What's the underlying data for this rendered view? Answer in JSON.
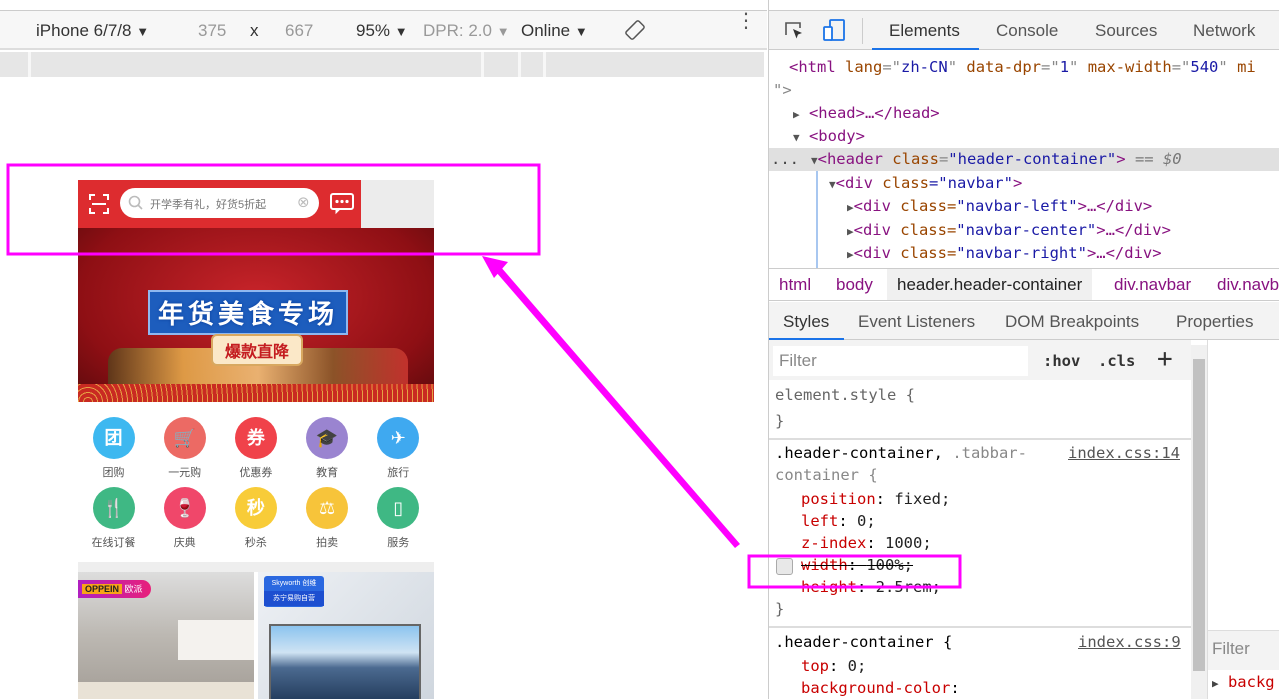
{
  "device_toolbar": {
    "device": "iPhone 6/7/8",
    "width": "375",
    "times": "x",
    "height": "667",
    "zoom": "95%",
    "dpr": "DPR: 2.0",
    "network": "Online",
    "dropdown": "▼",
    "rotate_icon": "rotate-icon",
    "more_icon": "more-vertical-icon"
  },
  "phone": {
    "header_color": "#dd2c2f",
    "search_placeholder": "开学季有礼，好货5折起",
    "banner": {
      "title": "年货美食专场",
      "tag": "爆款直降"
    },
    "icons": [
      {
        "label": "团购",
        "color": "#3db8f0",
        "glyph": "团"
      },
      {
        "label": "一元购",
        "color": "#ec6a64",
        "glyph": "🛒"
      },
      {
        "label": "优惠券",
        "color": "#f0424a",
        "glyph": "券"
      },
      {
        "label": "教育",
        "color": "#9a84d0",
        "glyph": "🎓"
      },
      {
        "label": "旅行",
        "color": "#3fa9f0",
        "glyph": "✈"
      },
      {
        "label": "在线订餐",
        "color": "#3fb884",
        "glyph": "🍴"
      },
      {
        "label": "庆典",
        "color": "#f0476a",
        "glyph": "🍷"
      },
      {
        "label": "秒杀",
        "color": "#f8cc38",
        "glyph": "秒"
      },
      {
        "label": "拍卖",
        "color": "#f7c43a",
        "glyph": "⚖"
      },
      {
        "label": "服务",
        "color": "#3fb884",
        "glyph": "▯"
      }
    ],
    "promo_left": {
      "brand": "OPPEIN",
      "tag": "欧派"
    },
    "promo_right": {
      "brand": "Skyworth 创维",
      "sub": "苏宁易购自营"
    }
  },
  "devtools": {
    "tabs": [
      "Elements",
      "Console",
      "Sources",
      "Network"
    ],
    "active_tab": "Elements",
    "dom": {
      "html_line": [
        "<html",
        " lang",
        "=\"",
        "zh-CN",
        "\"",
        " data-dpr",
        "=\"",
        "1",
        "\"",
        " max-width",
        "=\"",
        "540",
        "\"",
        " mi"
      ],
      "quote_close": "\">",
      "head": "<head>…</head>",
      "body": "<body>",
      "header_tag": "<header",
      "header_attr": " class",
      "header_val": "\"header-container\"",
      "header_close": ">",
      "selected_marker": " == $0",
      "dots": "...",
      "navbar": [
        "<div",
        " class",
        "=\"navbar\"",
        ">"
      ],
      "children": [
        {
          "cls": "\"navbar-left\""
        },
        {
          "cls": "\"navbar-center\""
        },
        {
          "cls": "\"navbar-right\""
        }
      ],
      "div_open": "<div",
      "class_attr": " class=",
      "ellipsis_close": ">…</div>"
    },
    "breadcrumbs": [
      "html",
      "body",
      "header.header-container",
      "div.navbar",
      "div.navb"
    ],
    "style_tabs": [
      "Styles",
      "Event Listeners",
      "DOM Breakpoints",
      "Properties"
    ],
    "filter_placeholder": "Filter",
    "hov": ":hov",
    "cls": ".cls",
    "plus": "+",
    "rules": {
      "element_style": "element.style {",
      "close": "}",
      "rule1_selector_a": ".header-container, ",
      "rule1_selector_b": ".tabbar-",
      "rule1_selector_c": "container {",
      "rule1_source": "index.css:14",
      "rule1_props": [
        {
          "name": "position",
          "value": "fixed;"
        },
        {
          "name": "left",
          "value": "0;"
        },
        {
          "name": "z-index",
          "value": "1000;"
        },
        {
          "name": "width",
          "value": "100%;",
          "disabled": true
        },
        {
          "name": "height",
          "value": "2.5rem;"
        }
      ],
      "rule2_selector": ".header-container {",
      "rule2_source": "index.css:9",
      "rule2_props": [
        {
          "name": "top",
          "value": "0;"
        },
        {
          "name": "background-color",
          "value": ""
        }
      ]
    },
    "computed_filter": "Filter",
    "computed_item": "backg"
  },
  "annotation_color": "#ff00ff"
}
